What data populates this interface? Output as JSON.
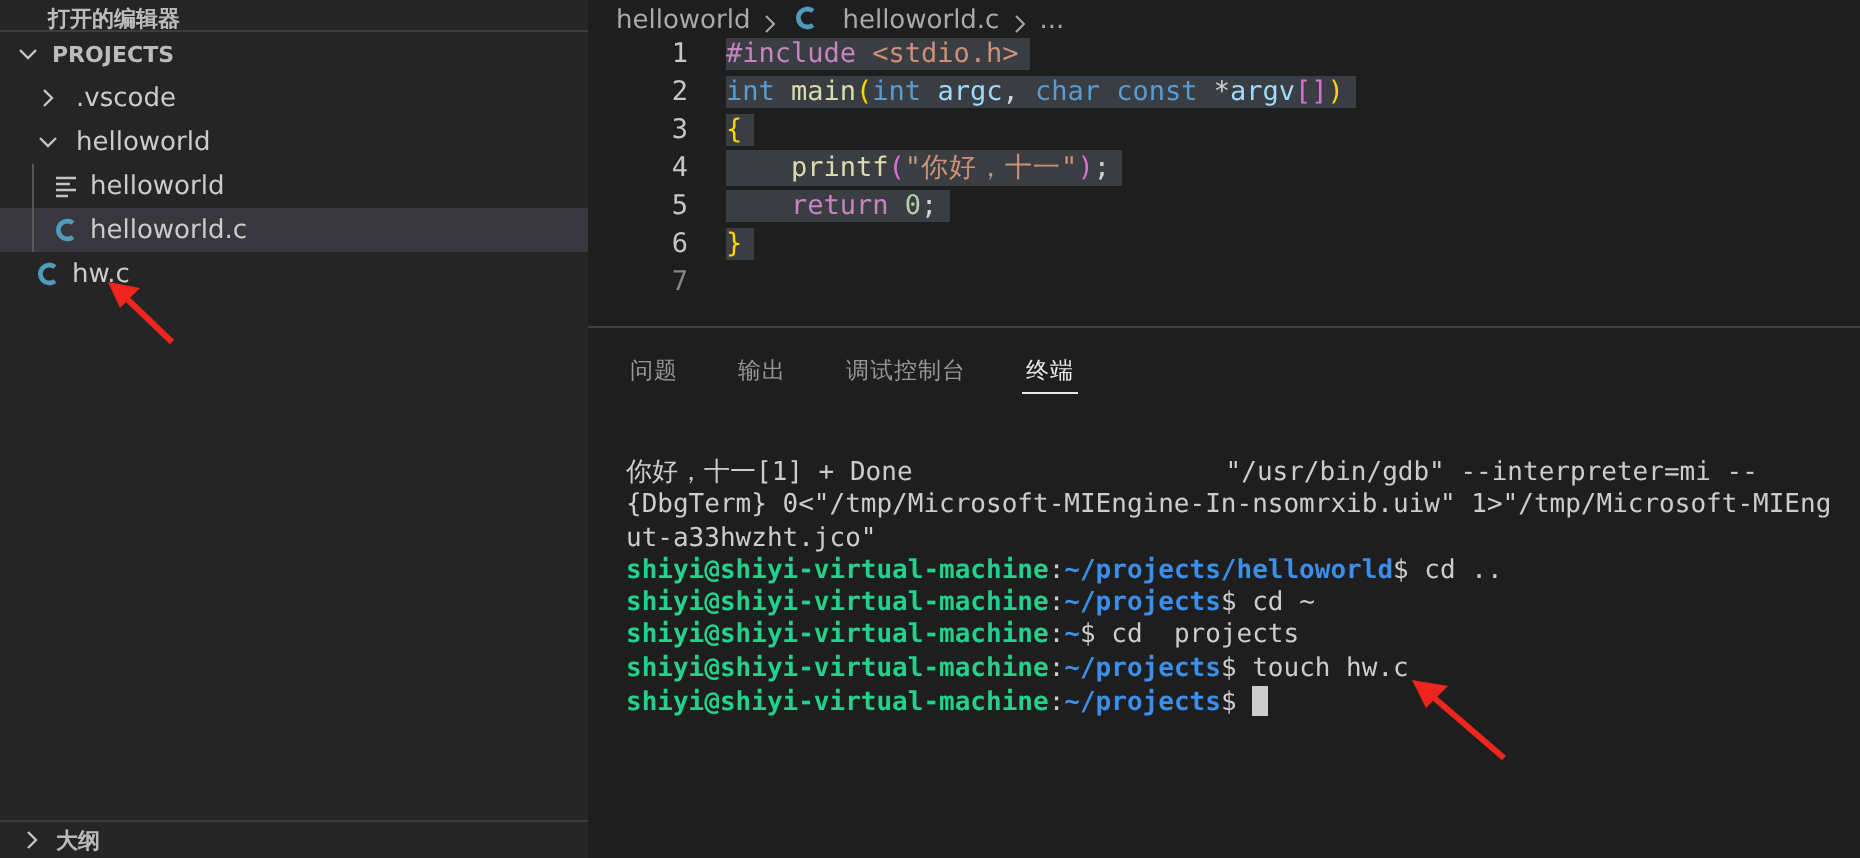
{
  "sidebar": {
    "open_editors_header": "打开的编辑器",
    "tree": {
      "label": "PROJECTS",
      "expanded": true,
      "children": [
        {
          "label": ".vscode",
          "kind": "folder",
          "expanded": false,
          "selected": false
        },
        {
          "label": "helloworld",
          "kind": "folder",
          "expanded": true,
          "selected": false,
          "children": [
            {
              "label": "helloworld",
              "kind": "binary",
              "selected": false
            },
            {
              "label": "helloworld.c",
              "kind": "c",
              "selected": true
            }
          ]
        },
        {
          "label": "hw.c",
          "kind": "c",
          "selected": false
        }
      ]
    },
    "outline": {
      "label": "大纲",
      "expanded": false
    }
  },
  "breadcrumb": [
    {
      "label": "helloworld",
      "kind": "folder"
    },
    {
      "label": "helloworld.c",
      "kind": "c"
    },
    {
      "label": "...",
      "kind": "more"
    }
  ],
  "editor": {
    "lines": [
      {
        "number": "1",
        "selected": true,
        "tokens": [
          {
            "kind": "directive",
            "text": "#include "
          },
          {
            "kind": "string",
            "text": "<stdio.h>"
          }
        ]
      },
      {
        "number": "2",
        "selected": true,
        "tokens": [
          {
            "kind": "keyword",
            "text": "int "
          },
          {
            "kind": "function",
            "text": "main"
          },
          {
            "kind": "bracket",
            "text": "("
          },
          {
            "kind": "keyword",
            "text": "int "
          },
          {
            "kind": "variable",
            "text": "argc"
          },
          {
            "kind": "plain",
            "text": ", "
          },
          {
            "kind": "keyword",
            "text": "char const "
          },
          {
            "kind": "plain",
            "text": "*"
          },
          {
            "kind": "variable",
            "text": "argv"
          },
          {
            "kind": "bracket2",
            "text": "[]"
          },
          {
            "kind": "bracket",
            "text": ")"
          }
        ]
      },
      {
        "number": "3",
        "selected": true,
        "tokens": [
          {
            "kind": "bracket",
            "text": "{"
          }
        ]
      },
      {
        "number": "4",
        "selected": true,
        "tokens": [
          {
            "kind": "function",
            "text": "    printf"
          },
          {
            "kind": "bracket2",
            "text": "("
          },
          {
            "kind": "string",
            "text": "\"你好，十一\""
          },
          {
            "kind": "bracket2",
            "text": ")"
          },
          {
            "kind": "plain",
            "text": ";"
          }
        ]
      },
      {
        "number": "5",
        "selected": true,
        "tokens": [
          {
            "kind": "control",
            "text": "    return "
          },
          {
            "kind": "number",
            "text": "0"
          },
          {
            "kind": "plain",
            "text": ";"
          }
        ]
      },
      {
        "number": "6",
        "selected": true,
        "tokens": [
          {
            "kind": "bracket",
            "text": "}"
          }
        ]
      },
      {
        "number": "7",
        "selected": false
      }
    ]
  },
  "panel": {
    "tabs": [
      {
        "label": "问题",
        "selected": false
      },
      {
        "label": "输出",
        "selected": false
      },
      {
        "label": "调试控制台",
        "selected": false
      },
      {
        "label": "终端",
        "selected": true
      }
    ],
    "terminal": {
      "lines": [
        [
          {
            "kind": "text",
            "text": "你好，十一[1] + Done                    \"/usr/bin/gdb\" --interpreter=mi --"
          }
        ],
        [
          {
            "kind": "text",
            "text": "{DbgTerm} 0<\"/tmp/Microsoft-MIEngine-In-nsomrxib.uiw\" 1>\"/tmp/Microsoft-MIEng"
          }
        ],
        [
          {
            "kind": "text",
            "text": "ut-a33hwzht.jco\""
          }
        ],
        [
          {
            "kind": "user",
            "text": "shiyi@shiyi-virtual-machine"
          },
          {
            "kind": "text",
            "text": ":"
          },
          {
            "kind": "path",
            "text": "~/projects/helloworld"
          },
          {
            "kind": "text",
            "text": "$ cd .."
          }
        ],
        [
          {
            "kind": "user",
            "text": "shiyi@shiyi-virtual-machine"
          },
          {
            "kind": "text",
            "text": ":"
          },
          {
            "kind": "path",
            "text": "~/projects"
          },
          {
            "kind": "text",
            "text": "$ cd ~"
          }
        ],
        [
          {
            "kind": "user",
            "text": "shiyi@shiyi-virtual-machine"
          },
          {
            "kind": "text",
            "text": ":"
          },
          {
            "kind": "path",
            "text": "~"
          },
          {
            "kind": "text",
            "text": "$ cd  projects"
          }
        ],
        [
          {
            "kind": "user",
            "text": "shiyi@shiyi-virtual-machine"
          },
          {
            "kind": "text",
            "text": ":"
          },
          {
            "kind": "path",
            "text": "~/projects"
          },
          {
            "kind": "text",
            "text": "$ touch hw.c"
          }
        ],
        [
          {
            "kind": "user",
            "text": "shiyi@shiyi-virtual-machine"
          },
          {
            "kind": "text",
            "text": ":"
          },
          {
            "kind": "path",
            "text": "~/projects"
          },
          {
            "kind": "text",
            "text": "$ "
          },
          {
            "kind": "cursor"
          }
        ]
      ]
    }
  }
}
